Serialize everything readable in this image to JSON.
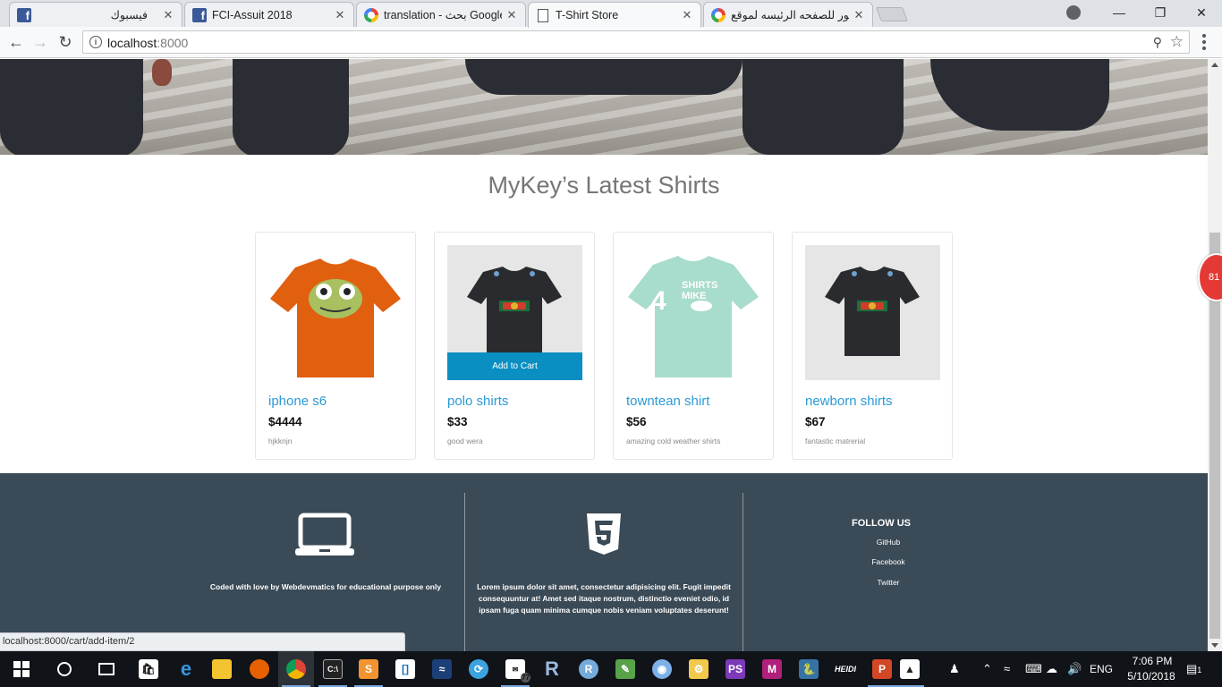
{
  "browser": {
    "tabs": [
      {
        "title": "فيسبوك",
        "icon": "facebook-icon"
      },
      {
        "title": "FCI-Assuit 2018",
        "icon": "facebook-icon"
      },
      {
        "title": "translation - بحث Google",
        "icon": "google-icon"
      },
      {
        "title": "T-Shirt Store",
        "icon": "document-icon",
        "active": true
      },
      {
        "title": "صور للصفحه الرئيسه لموقع",
        "icon": "google-icon"
      }
    ],
    "close_glyph": "✕",
    "url_host": "localhost",
    "url_port": ":8000",
    "status_url": "localhost:8000/cart/add-item/2"
  },
  "page": {
    "section_title": "MyKey’s Latest Shirts",
    "add_to_cart_label": "Add to Cart",
    "products": [
      {
        "name": "iphone s6",
        "price": "$4444",
        "description": "hjkknjn",
        "image": "orange-frog-tshirt"
      },
      {
        "name": "polo shirts",
        "price": "$33",
        "description": "good wera",
        "image": "black-gucci-tshirt"
      },
      {
        "name": "towntean shirt",
        "price": "$56",
        "description": "amazing cold weather shirts",
        "image": "mint-shirts4mike-tshirt"
      },
      {
        "name": "newborn shirts",
        "price": "$67",
        "description": "fantastic matrerial",
        "image": "black-gucci-tshirt"
      }
    ],
    "footer": {
      "col1_text": "Coded with love by Webdevmatics for educational purpose only",
      "col2_text": "Lorem ipsum dolor sit amet, consectetur adipisicing elit. Fugit impedit consequuntur at! Amet sed itaque nostrum, distinctio eveniet odio, id ipsam fuga quam minima cumque nobis veniam voluptates deserunt!",
      "follow_title": "FOLLOW US",
      "links": [
        "GitHub",
        "Facebook",
        "Twitter"
      ]
    },
    "notification_badge": "81"
  },
  "taskbar": {
    "language": "ENG",
    "time": "7:06 PM",
    "date": "5/10/2018",
    "notification_count": "1",
    "badge_77": "77"
  }
}
